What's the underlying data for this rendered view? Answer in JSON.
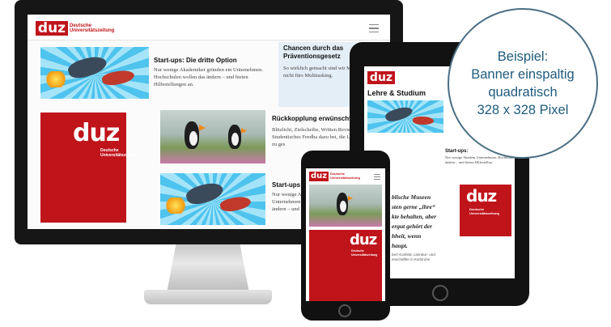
{
  "brand": {
    "logo_word": "duz",
    "logo_sub_line1": "Deutsche",
    "logo_sub_line2": "Universitätszeitung",
    "color_red": "#c0141b",
    "color_accent_blue": "#1f5b7d"
  },
  "callout": {
    "line1": "Beispiel:",
    "line2": "Banner einspaltig",
    "line3": "quadratisch",
    "line4": "328 x 328 Pixel"
  },
  "desktop": {
    "article1": {
      "title": "Start-ups: Die dritte Option",
      "text": "Nur wenige Akademiker gründen ein Unternehmen. Hochschulen wollen das ändern – und bieten Hilfestellungen an."
    },
    "sidebar_box": {
      "title_line1": "Chancen durch das",
      "title_line2": "Präventionsgesetz",
      "text": "So wirklich gemacht sind wir M nicht fürs Multitasking."
    },
    "article2": {
      "title": "Rückkopplung erwünscht",
      "text": "Blitzlicht, Zielscheibe, Written Revie Minute Paper: Studentisches Feedba dazu bei, die Lehre intensiver zu ges"
    },
    "article3": {
      "title": "Start-ups:",
      "text": "Nur wenige A Unternehmen ändern – und"
    }
  },
  "tablet": {
    "section_title": "Lehre & Studium",
    "article_title": "Start-ups:",
    "article_text": "Nur wenige Akadem Unternehmen. Hochschul ändern – und bieten Hilfestellun"
  },
  "phone": {
    "quote_line1": "blische Museen",
    "quote_line2": "sten gerne „ihre“",
    "quote_line3": "kte behalten, aber",
    "quote_line4": "ergut gehört der",
    "quote_line5": "hheit, wenn",
    "quote_line6": "haupt.",
    "caption_line1": "bert Gosfeld, Literatur- und",
    "caption_line2": "enschaftler in Karlsruhe"
  }
}
